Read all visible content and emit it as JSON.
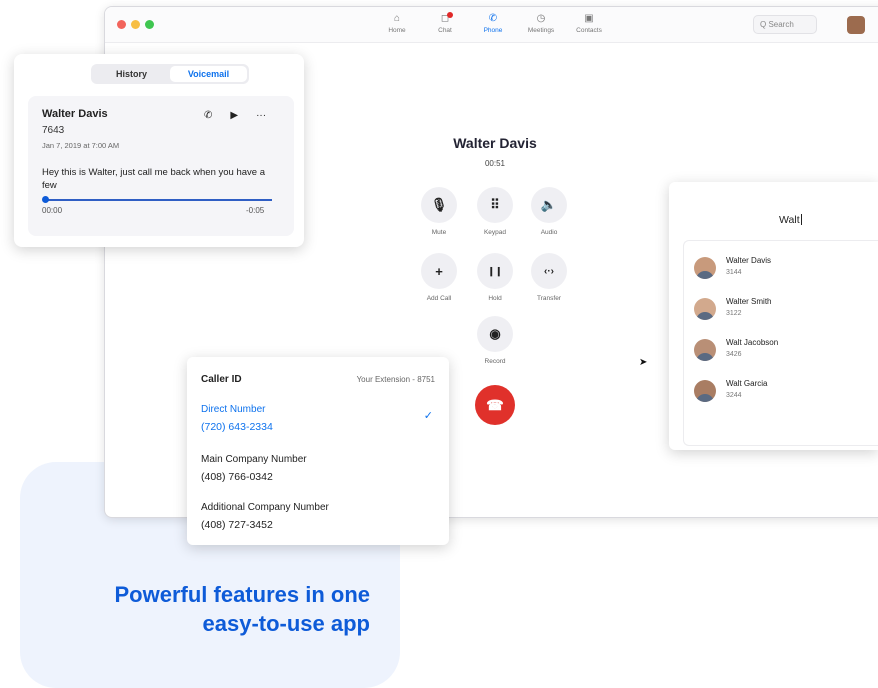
{
  "tagline": {
    "line1": "Powerful features in one",
    "line2": "easy-to-use app"
  },
  "window": {
    "nav": [
      {
        "label": "Home",
        "icon": "home-icon",
        "glyph": "⌂"
      },
      {
        "label": "Chat",
        "icon": "chat-icon",
        "glyph": "◻"
      },
      {
        "label": "Phone",
        "icon": "phone-icon",
        "glyph": "✆"
      },
      {
        "label": "Meetings",
        "icon": "clock-icon",
        "glyph": "◷"
      },
      {
        "label": "Contacts",
        "icon": "contacts-icon",
        "glyph": "▣"
      }
    ],
    "active_nav": "Phone",
    "search_placeholder": "Q  Search"
  },
  "call": {
    "name": "Walter Davis",
    "duration": "00:51",
    "controls": [
      {
        "label": "Mute",
        "icon": "microphone-icon",
        "glyph": "🎙"
      },
      {
        "label": "Keypad",
        "icon": "keypad-icon",
        "glyph": "⠿"
      },
      {
        "label": "Audio",
        "icon": "speaker-icon",
        "glyph": "🔈"
      },
      {
        "label": "Add Call",
        "icon": "plus-icon",
        "glyph": "+"
      },
      {
        "label": "Hold",
        "icon": "pause-icon",
        "glyph": "❙❙"
      },
      {
        "label": "Transfer",
        "icon": "transfer-icon",
        "glyph": "‹·›"
      },
      {
        "label": "Record",
        "icon": "record-icon",
        "glyph": "◉"
      }
    ],
    "end_glyph": "☎"
  },
  "voicemail_panel": {
    "tabs": [
      "History",
      "Voicemail"
    ],
    "active_tab": "Voicemail",
    "entry": {
      "name": "Walter Davis",
      "extension": "7643",
      "date": "Jan 7, 2019 at 7:00 AM",
      "message": "Hey this is Walter, just call me back when you have a few",
      "elapsed": "00:00",
      "remaining": "-0:05",
      "actions": [
        {
          "icon": "phone-icon",
          "glyph": "✆"
        },
        {
          "icon": "play-icon",
          "glyph": "▶"
        },
        {
          "icon": "more-icon",
          "glyph": "···"
        }
      ]
    }
  },
  "caller_id": {
    "title": "Caller ID",
    "extension_label": "Your Extension - 8751",
    "options": [
      {
        "label": "Direct Number",
        "number": "(720) 643-2334",
        "selected": true
      },
      {
        "label": "Main Company Number",
        "number": "(408) 766-0342",
        "selected": false
      },
      {
        "label": "Additional Company Number",
        "number": "(408) 727-3452",
        "selected": false
      }
    ],
    "check_glyph": "✓"
  },
  "contact_search": {
    "query": "Walt",
    "results": [
      {
        "name": "Walter Davis",
        "ext": "3144"
      },
      {
        "name": "Walter Smith",
        "ext": "3122"
      },
      {
        "name": "Walt Jacobson",
        "ext": "3426"
      },
      {
        "name": "Walt Garcia",
        "ext": "3244"
      }
    ]
  }
}
